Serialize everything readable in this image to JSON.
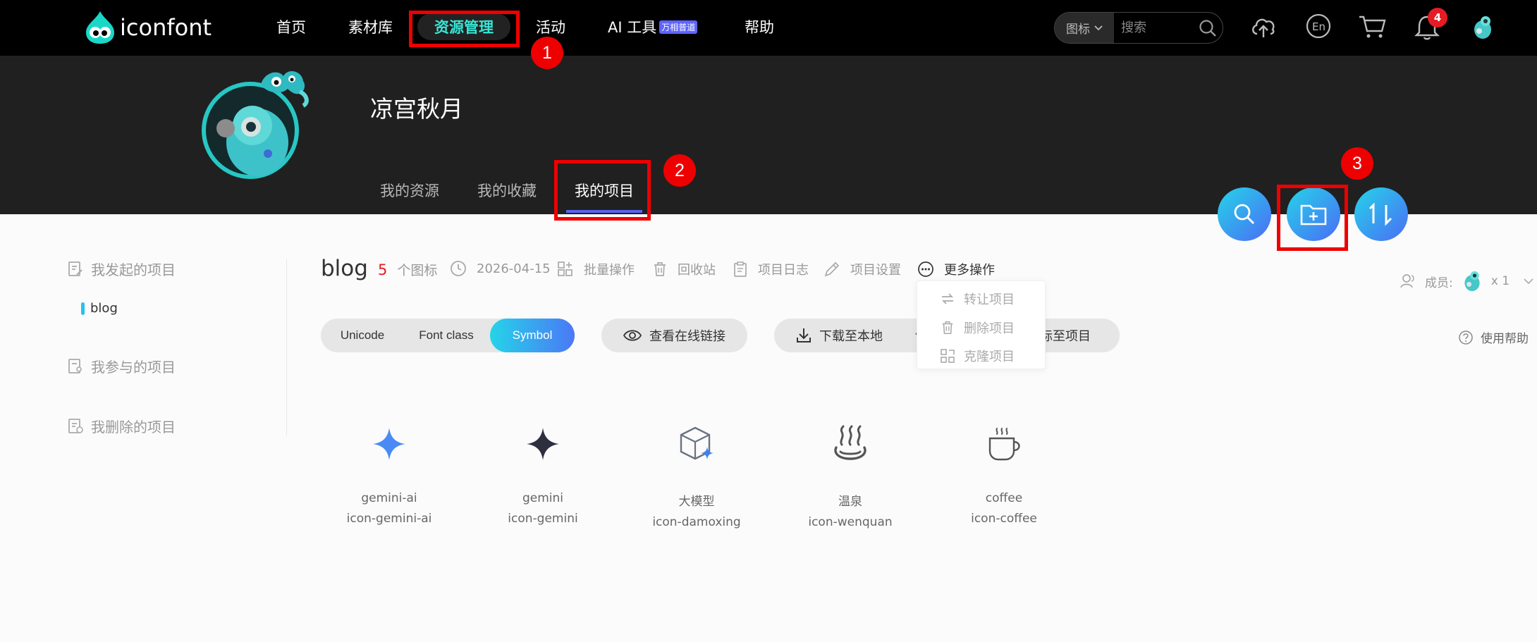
{
  "topbar": {
    "brand": "iconfont",
    "nav": [
      {
        "label": "首页"
      },
      {
        "label": "素材库"
      },
      {
        "label": "资源管理"
      },
      {
        "label": "活动"
      },
      {
        "label": "AI 工具",
        "badge": "万相普道"
      },
      {
        "label": "帮助"
      }
    ],
    "search": {
      "type_label": "图标",
      "placeholder": "搜索"
    },
    "notification_count": "4"
  },
  "profile": {
    "username": "凉宫秋月",
    "tabs": [
      {
        "label": "我的资源"
      },
      {
        "label": "我的收藏"
      },
      {
        "label": "我的项目"
      }
    ]
  },
  "annotations": [
    "1",
    "2",
    "3"
  ],
  "sidebar": {
    "items": [
      {
        "label": "我发起的项目"
      },
      {
        "label": "我参与的项目"
      },
      {
        "label": "我删除的项目"
      }
    ],
    "sub_item": "blog"
  },
  "project": {
    "name": "blog",
    "icon_count": "5",
    "icon_count_label": "个图标",
    "date": "2026-04-15",
    "actions": {
      "batch": "批量操作",
      "recycle": "回收站",
      "log": "项目日志",
      "settings": "项目设置",
      "more": "更多操作"
    },
    "more_menu": [
      "转让项目",
      "删除项目",
      "克隆项目"
    ],
    "formats": [
      "Unicode",
      "Font class",
      "Symbol"
    ],
    "active_format": "Symbol",
    "view_online": "查看在线链接",
    "download": "下载至本地",
    "add_to_project_partial": "标至项目",
    "members_label": "成员:",
    "members_count": "x 1",
    "help_label": "使用帮助"
  },
  "icons": [
    {
      "name": "gemini-ai",
      "code": "icon-gemini-ai"
    },
    {
      "name": "gemini",
      "code": "icon-gemini"
    },
    {
      "name": "大模型",
      "code": "icon-damoxing"
    },
    {
      "name": "温泉",
      "code": "icon-wenquan"
    },
    {
      "name": "coffee",
      "code": "icon-coffee"
    }
  ],
  "colors": {
    "accent": "#37e5d6",
    "annotation_red": "#ee0000",
    "gradient_start": "#25d4e8",
    "gradient_end": "#4b6cf6",
    "tab_underline": "#5865f2"
  }
}
